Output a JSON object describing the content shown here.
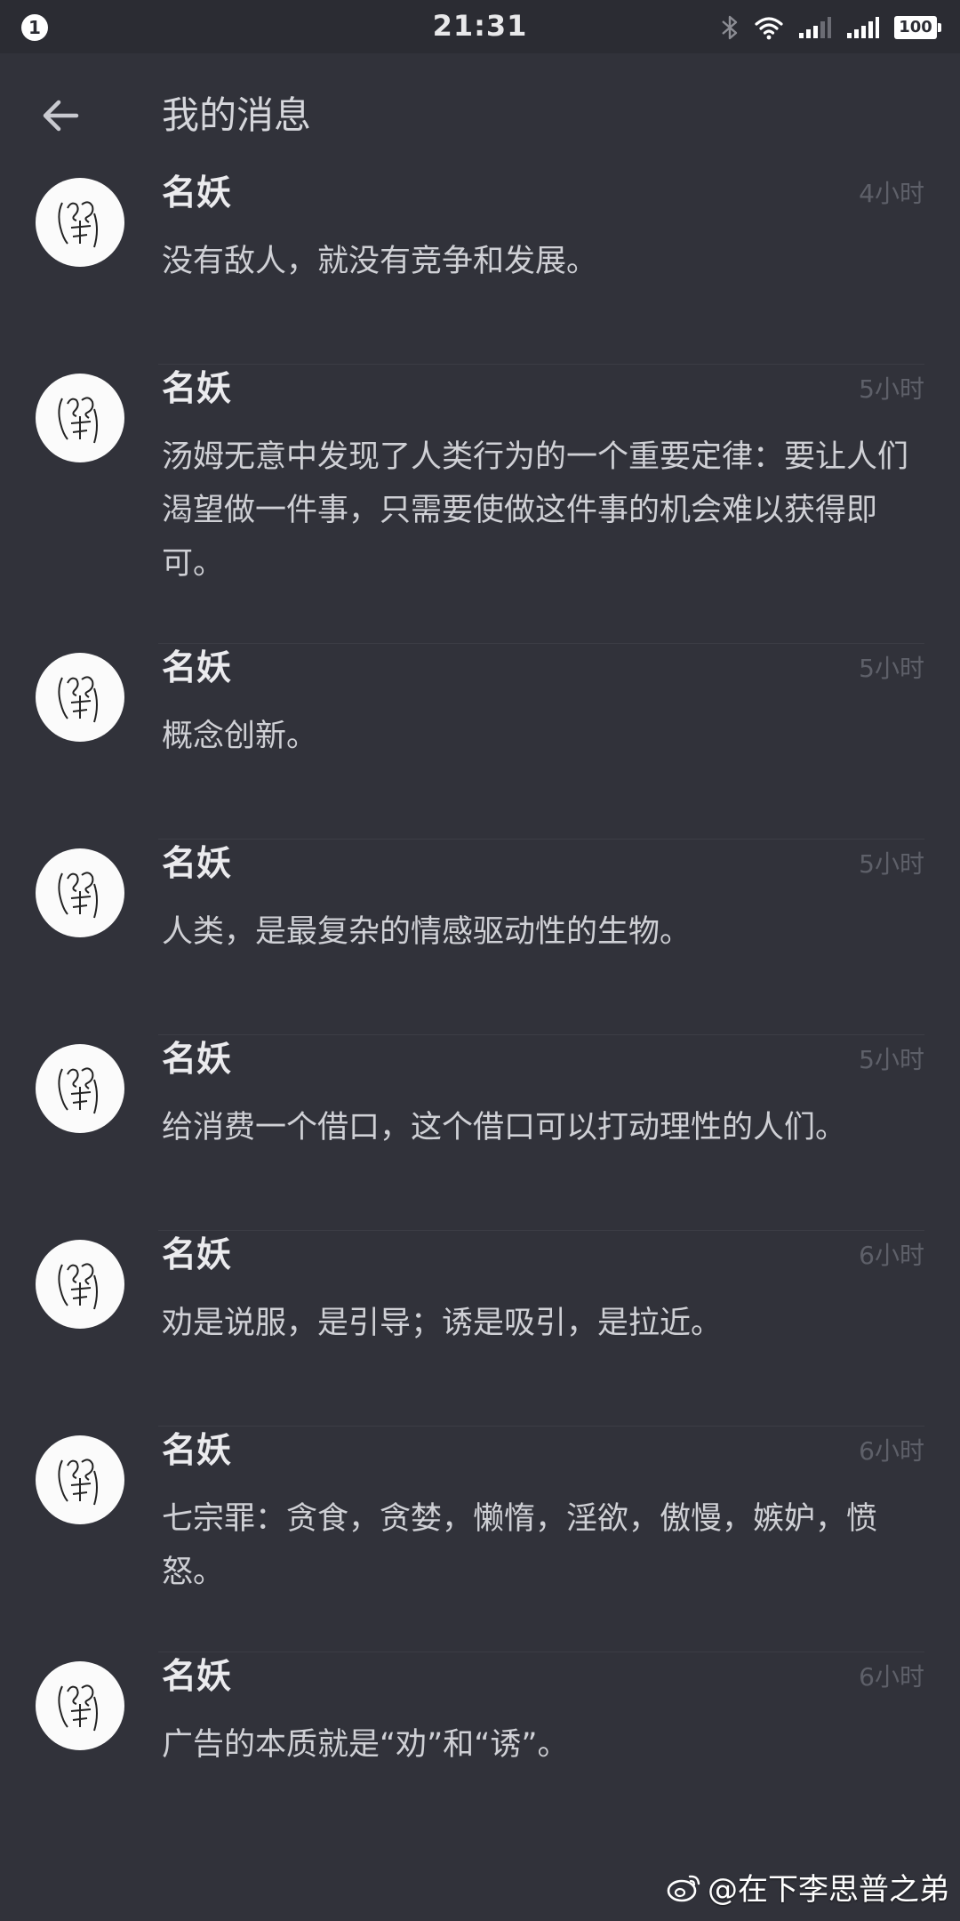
{
  "status_bar": {
    "notification_count": "1",
    "time": "21:31",
    "battery": "100",
    "icons": [
      "bluetooth-icon",
      "wifi-icon",
      "signal-icon",
      "signal-2-icon"
    ]
  },
  "header": {
    "title": "我的消息",
    "back_icon": "back-arrow-icon"
  },
  "messages": [
    {
      "sender": "名妖",
      "time": "4小时",
      "text": "没有敌人，就没有竞争和发展。"
    },
    {
      "sender": "名妖",
      "time": "5小时",
      "text": "汤姆无意中发现了人类行为的一个重要定律：要让人们渴望做一件事，只需要使做这件事的机会难以获得即可。"
    },
    {
      "sender": "名妖",
      "time": "5小时",
      "text": "概念创新。"
    },
    {
      "sender": "名妖",
      "time": "5小时",
      "text": "人类，是最复杂的情感驱动性的生物。"
    },
    {
      "sender": "名妖",
      "time": "5小时",
      "text": "给消费一个借口，这个借口可以打动理性的人们。"
    },
    {
      "sender": "名妖",
      "time": "6小时",
      "text": "劝是说服，是引导；诱是吸引，是拉近。"
    },
    {
      "sender": "名妖",
      "time": "6小时",
      "text": "七宗罪：贪食，贪婪，懒惰，淫欲，傲慢，嫉妒，愤怒。"
    },
    {
      "sender": "名妖",
      "time": "6小时",
      "text": "广告的本质就是“劝”和“诱”。"
    }
  ],
  "watermark": "@在下李思普之弟",
  "colors": {
    "background": "#31323a",
    "status_bar": "#2b2c33",
    "sender": "#ebebee",
    "text": "#cfd0d5",
    "time": "#5e6069",
    "divider": "#3c3d45"
  }
}
